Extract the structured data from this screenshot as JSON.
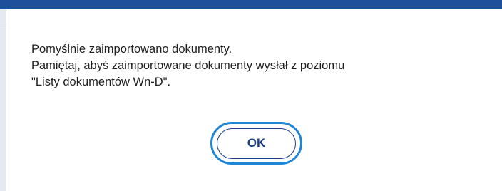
{
  "dialog": {
    "message_lines": [
      "Pomyślnie zaimportowano dokumenty.",
      "Pamiętaj, abyś zaimportowane dokumenty wysłał z poziomu",
      "\"Listy dokumentów Wn-D\"."
    ],
    "ok_label": "OK"
  },
  "colors": {
    "header_bar": "#1e4f9b",
    "button_outer_ring": "#1f86d6",
    "button_text": "#1a3f86"
  }
}
